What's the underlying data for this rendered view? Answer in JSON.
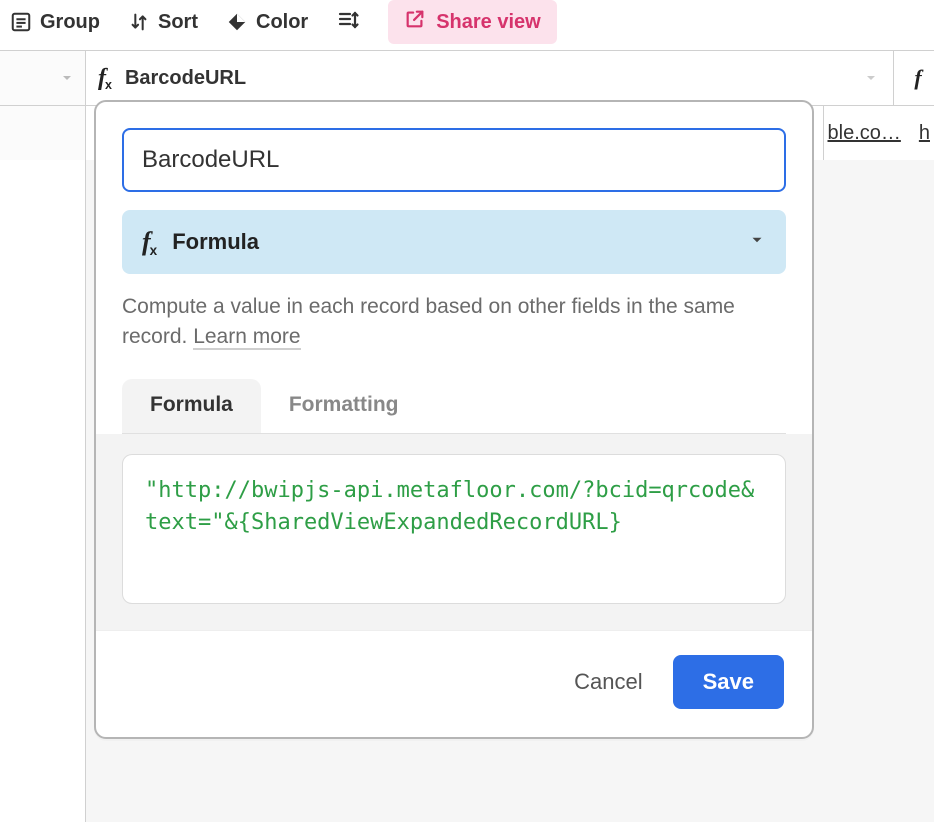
{
  "toolbar": {
    "group_label": "Group",
    "sort_label": "Sort",
    "color_label": "Color",
    "share_label": "Share view"
  },
  "column_header": {
    "title": "BarcodeURL"
  },
  "row_cells": {
    "truncated_url": "ble.co…",
    "next_cell_prefix": "h"
  },
  "field_edit": {
    "name_value": "BarcodeURL",
    "type_label": "Formula",
    "help_text": "Compute a value in each record based on other fields in the same record. ",
    "learn_more_label": "Learn more",
    "tabs": {
      "formula": "Formula",
      "formatting": "Formatting"
    },
    "formula_text": "\"http://bwipjs-api.metafloor.com/?bcid=qrcode&text=\"&{SharedViewExpandedRecordURL}",
    "cancel_label": "Cancel",
    "save_label": "Save"
  },
  "icons": {
    "group": "group-icon",
    "sort": "sort-icon",
    "color": "color-icon",
    "rowheight": "row-height-icon",
    "share": "share-icon",
    "caret_down": "caret-down-icon",
    "formula": "formula-fx-icon"
  }
}
